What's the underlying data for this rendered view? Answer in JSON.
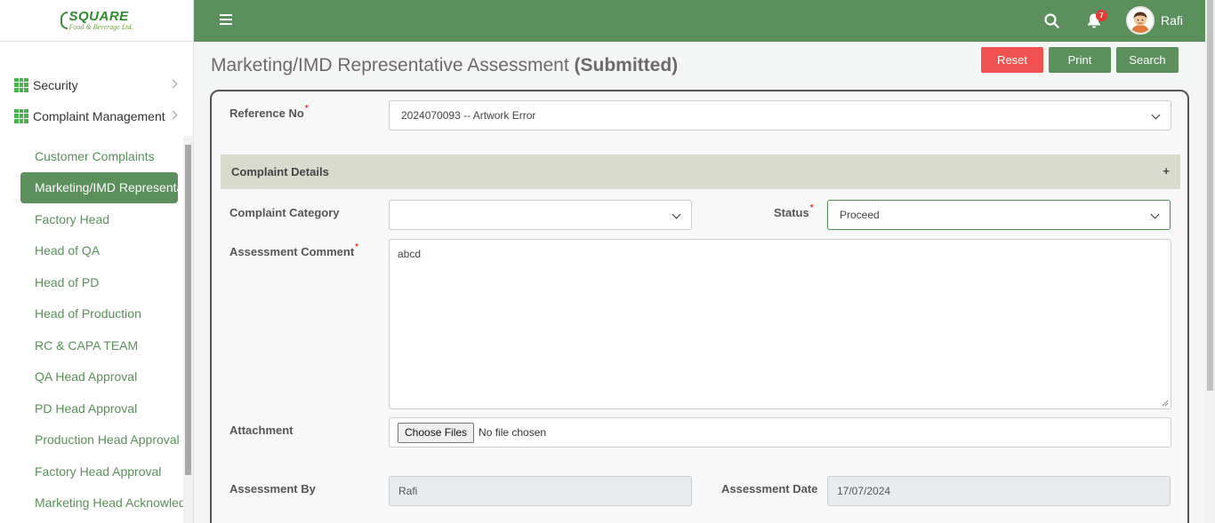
{
  "brand": {
    "logo_main": "SQUARE",
    "logo_sub": "Food & Beverage Ltd."
  },
  "sidebar": {
    "sections": [
      {
        "label": "Security",
        "icon": "grid-icon"
      },
      {
        "label": "Complaint Management",
        "icon": "grid-icon"
      }
    ],
    "items": [
      {
        "label": "Customer Complaints"
      },
      {
        "label": "Marketing/IMD Representative",
        "active": true
      },
      {
        "label": "Factory Head"
      },
      {
        "label": "Head of QA"
      },
      {
        "label": "Head of PD"
      },
      {
        "label": "Head of Production"
      },
      {
        "label": "RC & CAPA TEAM"
      },
      {
        "label": "QA Head Approval"
      },
      {
        "label": "PD Head Approval"
      },
      {
        "label": "Production Head Approval"
      },
      {
        "label": "Factory Head Approval"
      },
      {
        "label": "Marketing Head Acknowledge"
      }
    ]
  },
  "topbar": {
    "menu_icon": "hamburger-icon",
    "search_icon": "search-icon",
    "notification_icon": "bell-icon",
    "notification_count": "7",
    "user_name": "Rafi"
  },
  "page": {
    "title": "Marketing/IMD Representative Assessment",
    "status": "(Submitted)",
    "buttons": {
      "reset": "Reset",
      "print": "Print",
      "search": "Search"
    }
  },
  "form": {
    "reference_label": "Reference No",
    "reference_value": "2024070093 -- Artwork Error",
    "section_title": "Complaint Details",
    "section_toggle": "+",
    "category_label": "Complaint Category",
    "category_value": "",
    "status_label": "Status",
    "status_value": "Proceed",
    "comment_label": "Assessment Comment",
    "comment_value": "abcd",
    "attachment_label": "Attachment",
    "attachment_button": "Choose Files",
    "attachment_value": "No file chosen",
    "assessed_by_label": "Assessment By",
    "assessed_by_value": "Rafi",
    "assessment_date_label": "Assessment Date",
    "assessment_date_value": "17/07/2024"
  },
  "colors": {
    "primary_green": "#5b8f5b",
    "danger_red": "#f05252",
    "section_bg": "#d9dbcd",
    "badge_red": "#e53935"
  }
}
